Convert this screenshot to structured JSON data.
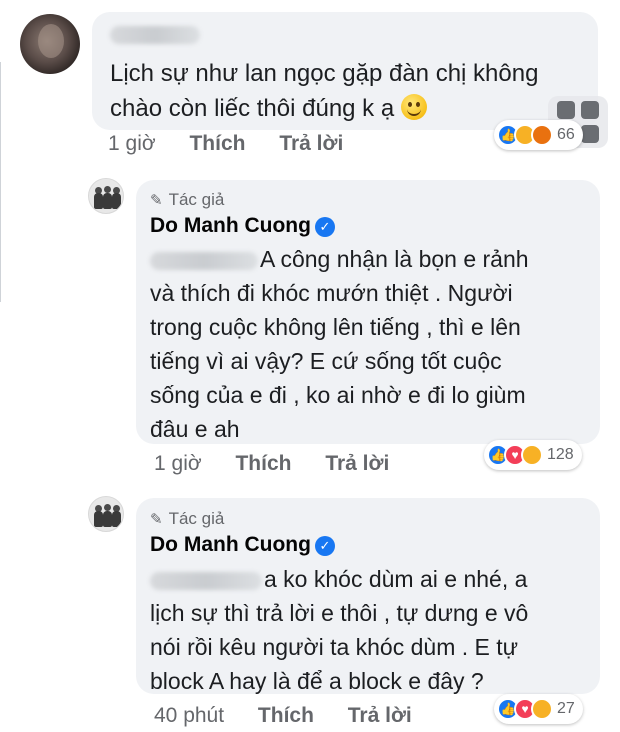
{
  "comment": {
    "text_line1": "Lịch sự như lan ngọc gặp đàn chị không",
    "text_line2": "chào còn liếc thôi đúng k ạ",
    "time": "1 giờ",
    "like": "Thích",
    "reply": "Trả lời",
    "reaction_count": "66"
  },
  "replies": [
    {
      "author_tag": "Tác giả",
      "author_name": "Do Manh Cuong",
      "line1": "A công nhận là bọn e rảnh",
      "line2": "và thích đi khóc mướn thiệt . Người",
      "line3": "trong cuộc không lên tiếng , thì e lên",
      "line4": "tiếng vì ai vậy? E cứ sống tốt cuộc",
      "line5": "sống của e đi , ko ai nhờ e đi lo giùm",
      "line6": "đâu e ah",
      "time": "1 giờ",
      "like": "Thích",
      "reply": "Trả lời",
      "reaction_count": "128"
    },
    {
      "author_tag": "Tác giả",
      "author_name": "Do Manh Cuong",
      "line1": "a ko khóc dùm ai e nhé, a",
      "line2": "lịch sự thì trả lời e thôi , tự dưng e vô",
      "line3": "nói rồi kêu người ta khóc dùm . E tự",
      "line4": "block A hay là để a block e đây ?",
      "time": "40 phút",
      "like": "Thích",
      "reply": "Trả lời",
      "reaction_count": "27"
    }
  ],
  "colors": {
    "bubble": "#f0f2f5",
    "secondary_text": "#65676b",
    "like_blue": "#1877f2",
    "love_red": "#f33e58",
    "haha_yellow": "#f7b125"
  }
}
